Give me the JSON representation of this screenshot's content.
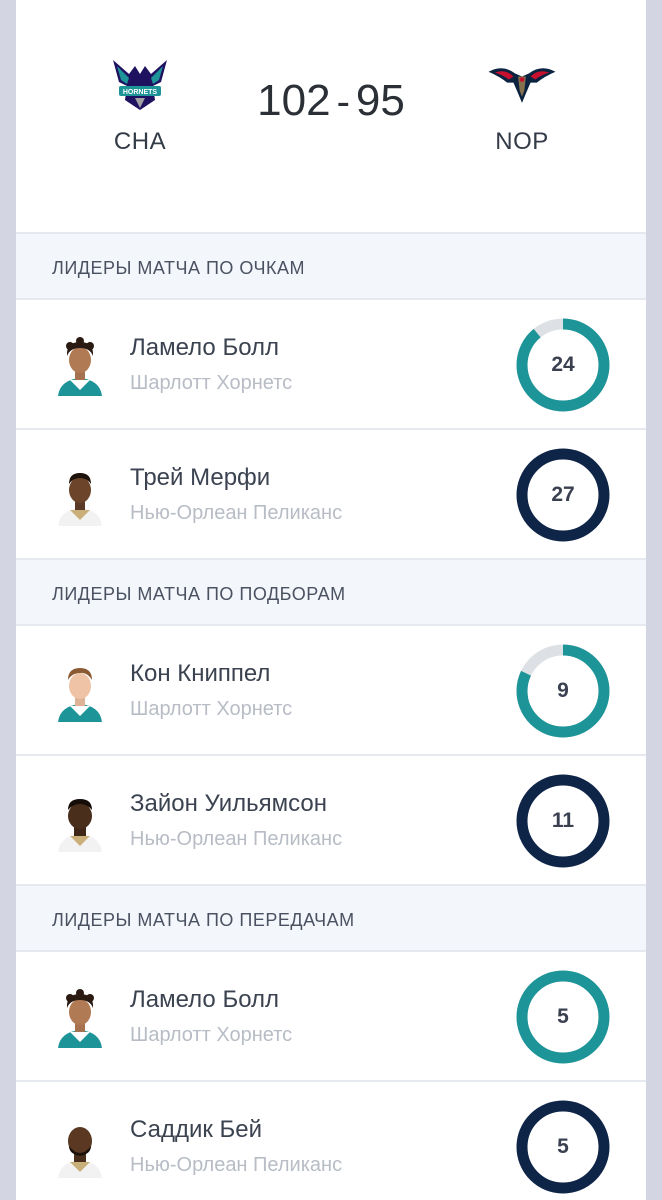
{
  "colors": {
    "home": "#1d9497",
    "away": "#0f2547",
    "track": "#dde1e6"
  },
  "game": {
    "home_abbr": "CHA",
    "away_abbr": "NOP",
    "home_score": "102",
    "separator": "-",
    "away_score": "95",
    "home_logo": "hornets-logo-icon",
    "away_logo": "pelicans-logo-icon"
  },
  "sections": {
    "points": {
      "title": "ЛИДЕРЫ МАТЧА ПО ОЧКАМ",
      "leaders": [
        {
          "name": "Ламело Болл",
          "team": "Шарлотт Хорнетс",
          "value": "24",
          "side": "home",
          "fraction": 0.89
        },
        {
          "name": "Трей Мерфи",
          "team": "Нью-Орлеан Пеликанс",
          "value": "27",
          "side": "away",
          "fraction": 1.0
        }
      ]
    },
    "rebounds": {
      "title": "ЛИДЕРЫ МАТЧА ПО ПОДБОРАМ",
      "leaders": [
        {
          "name": "Кон Книппел",
          "team": "Шарлотт Хорнетс",
          "value": "9",
          "side": "home",
          "fraction": 0.82
        },
        {
          "name": "Зайон Уильямсон",
          "team": "Нью-Орлеан Пеликанс",
          "value": "11",
          "side": "away",
          "fraction": 1.0
        }
      ]
    },
    "assists": {
      "title": "ЛИДЕРЫ МАТЧА ПО ПЕРЕДАЧАМ",
      "leaders": [
        {
          "name": "Ламело Болл",
          "team": "Шарлотт Хорнетс",
          "value": "5",
          "side": "home",
          "fraction": 1.0
        },
        {
          "name": "Саддик Бей",
          "team": "Нью-Орлеан Пеликанс",
          "value": "5",
          "side": "away",
          "fraction": 1.0
        }
      ]
    }
  }
}
